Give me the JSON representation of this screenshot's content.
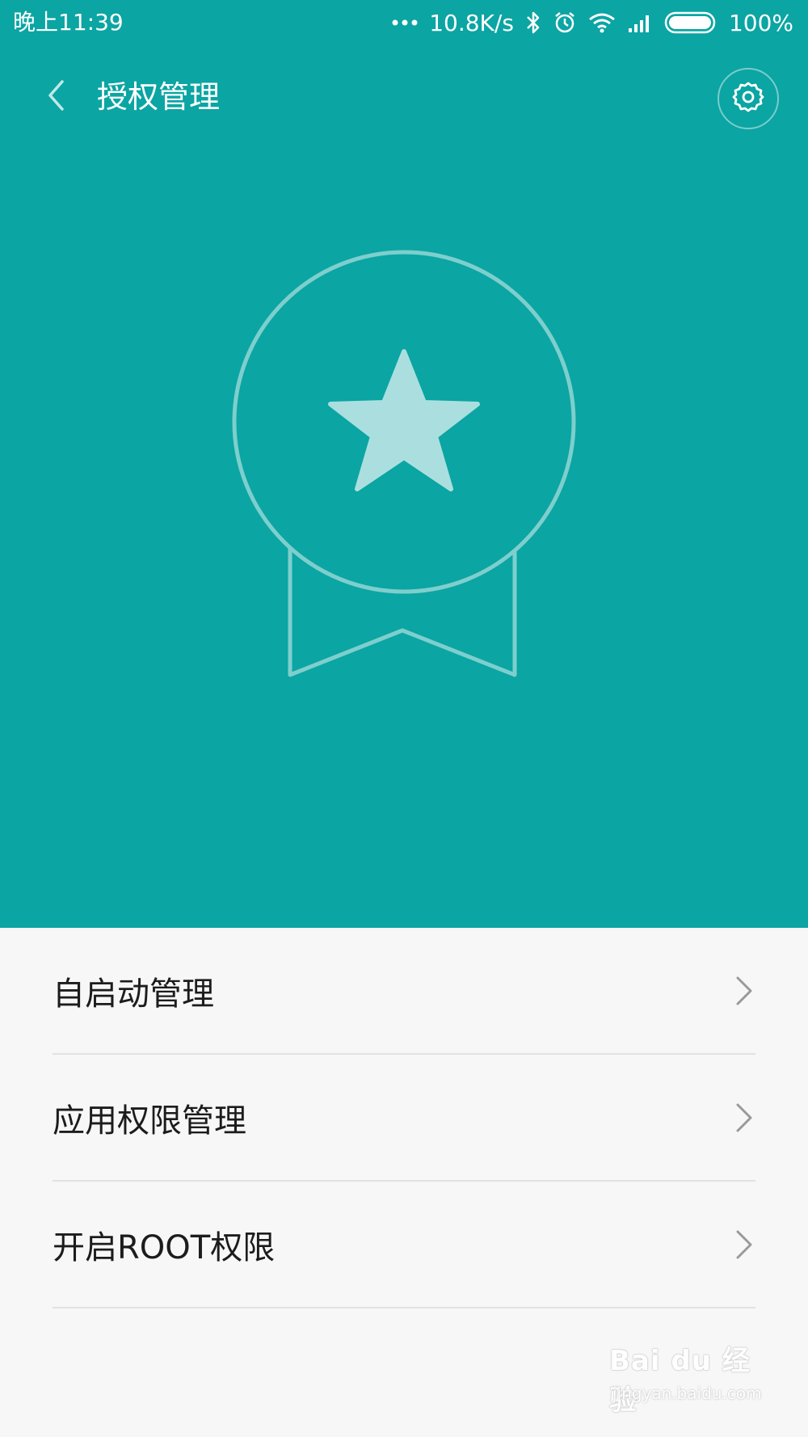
{
  "status_bar": {
    "time": "晚上11:39",
    "network_speed": "10.8K/s",
    "battery_percent": "100%",
    "icons": [
      "more-dots-icon",
      "bluetooth-icon",
      "alarm-icon",
      "wifi-icon",
      "signal-icon",
      "battery-icon"
    ]
  },
  "app_bar": {
    "title": "授权管理",
    "back_icon": "chevron-left-icon",
    "settings_icon": "gear-icon"
  },
  "hero": {
    "icon": "medal-star-icon",
    "background_color": "#0ba5a3"
  },
  "menu": {
    "items": [
      {
        "label": "自启动管理",
        "icon": "chevron-right-icon"
      },
      {
        "label": "应用权限管理",
        "icon": "chevron-right-icon"
      },
      {
        "label": "开启ROOT权限",
        "icon": "chevron-right-icon"
      }
    ]
  },
  "watermark": {
    "brand": "Bai du 经验",
    "url": "jingyan.baidu.com"
  }
}
